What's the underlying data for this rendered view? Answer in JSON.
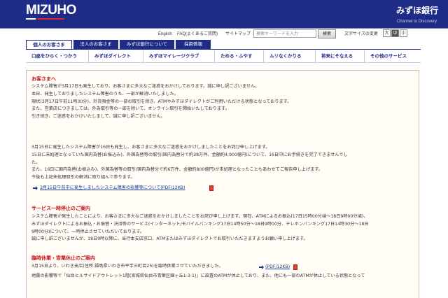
{
  "header": {
    "logo": "MIZUHO",
    "brand_jp": "みずほ銀行",
    "tagline": "Channel to Discovery"
  },
  "utility": {
    "english": "English",
    "faq": "FAQ(よくあるご質問)",
    "sitemap": "サイトマップ",
    "search_placeholder": "検索キーワードを入力",
    "search_button": "検索",
    "text_size_label": "文字サイズの変更",
    "text_size_large": "大",
    "text_size_medium": "中",
    "text_size_small": "小"
  },
  "category_tabs": [
    "個人のお客さま",
    "法人のお客さま",
    "みずほ銀行について",
    "採用情報"
  ],
  "main_nav": [
    "口座をひらく・つかう",
    "みずほダイレクト",
    "みずほマイレージクラブ",
    "ためる・ふやす",
    "ムリなくかりる",
    "将来にそなえる",
    "その他のサービス"
  ],
  "notice": {
    "title": "お客さまへ",
    "lines": [
      "システム障害が3月17日も発生しており、お客さまに多大なご迷惑をおかけしております。誠に申し訳ございません。",
      "本日、発生しておりましたシステム障害のうち、一部が解消いたしました。",
      "現状(3月17日午前11時30分)、外貨預金等の一部の取引を除き、ATMやみずほダイレクトがご利用いただける状態となっております。",
      "また、営業店につきましては、外為取引等の一部を除いて、オンライン取引を開始いたしております。",
      "引き続き、ご迷惑をおかけいたしまして、誠に申し訳ございません。"
    ]
  },
  "incident": {
    "lines": [
      "3月15日に発生したシステム障害が16日も発生し、お客さまに多大なご迷惑をおかけしましたことをお詫び申し上げます。",
      "15日に未処理となっていた国内為替(お振込み)、外国為替等の取引(国内為替分で約38万件、金額約4,900億円)について、16日中にお手続きを完了できませんでし",
      "た。",
      "また、16日に国内為替(お振込み)、外国為替等の取引(国内為替分で約6万件、金額約800億円)が未処理となったこともあわせてご報告申し上げます。",
      "今後も上記未処理取引の解消に取り組んで参ります。"
    ],
    "link": "3月15日午前中に発生しましたシステム障害の影響等について(PDF/12KB)"
  },
  "suspension": {
    "title": "サービス一時停止のご案内",
    "lines": [
      "システム障害が発生したことにより、お客さまに多大なご迷惑をおかけしましたことをお詫び申し上げます。現在、ATMによるお振込(17日15時00分頃〜18日9時00分頃)、",
      "みずほダイレクトによるお振込・お振替・決済等のサービス(インターネット/モバイルバンキング17日14時50分〜18日9時00分、テレホンバンキング17日14時30分〜18日",
      "9時00分)について、一時停止させていただいております。",
      "誠に申し訳ございませんが、18日9時以降に、当行本支店窓口、ATMまたはみずほダイレクトでお取引いただきますようお願い申し上げます。"
    ]
  },
  "closure": {
    "title": "臨時休業・営業休止のご案内",
    "line1": "3月15日より、いわき支店(住所:福島県いわき市平字三町目25)を臨時休業させていただきました。",
    "link": "(PDF/12KB)",
    "line2": "地震の影響等で「仙台ヒルサイドアウトレット1階(宮城県仙台市青葉区錦ヶ丘1-3-1)」に設置のATMが休止しており、また、他にも一部のATMが休止している状態となって"
  }
}
